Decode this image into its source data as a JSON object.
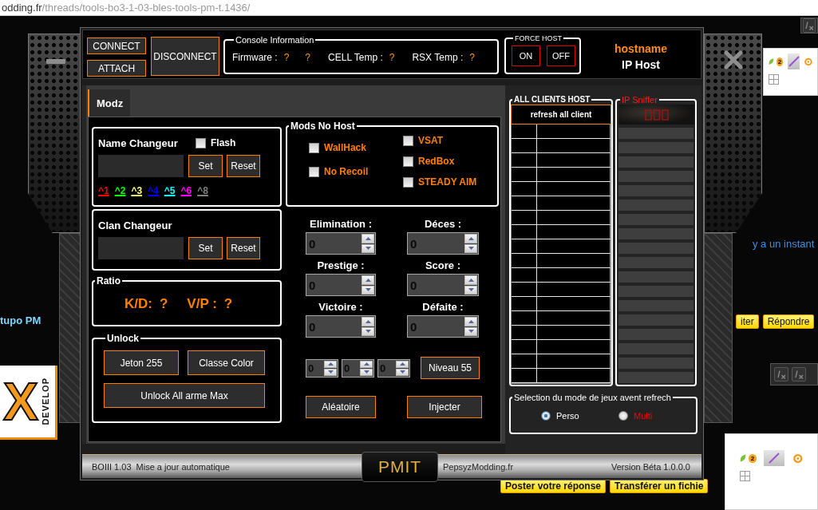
{
  "browser": {
    "url_host": "odding.fr",
    "url_path": "/threads/tools-bo3-1-03-bles-tools-pm-t.1436/"
  },
  "backdrop": {
    "forum_tag": "tupo PM",
    "logo_letter": "X",
    "logo_word": "DEVELOP",
    "post_time": "y a un instant",
    "post_buttons": [
      "iter",
      "Répondre"
    ],
    "reply_buttons": [
      "Poster votre réponse",
      "Transférer un fichie"
    ],
    "tray_panels": [
      {
        "badge": "2"
      },
      {
        "badge": "2"
      }
    ]
  },
  "header": {
    "connect_buttons": [
      "CONNECT",
      "ATTACH"
    ],
    "disconnect": "DISCONNECT",
    "console": {
      "title": "Console Information",
      "items": [
        {
          "label": "Firmware :",
          "values": [
            "?",
            "?"
          ]
        },
        {
          "label": "CELL Temp :",
          "values": [
            "?"
          ]
        },
        {
          "label": "RSX Temp :",
          "values": [
            "?"
          ]
        }
      ]
    },
    "force_host": {
      "title": "FORCE HOST",
      "buttons": [
        "ON",
        "OFF"
      ]
    },
    "hostname": "hostname",
    "ip_host": "IP Host"
  },
  "tabs": [
    {
      "label": "Modz",
      "selected": true
    }
  ],
  "name_changer": {
    "title": "Name Changeur",
    "flash": {
      "label": "Flash",
      "checked": false
    },
    "buttons": [
      "Set",
      "Reset"
    ],
    "color_codes": [
      {
        "label": "^1",
        "color": "#ff0000"
      },
      {
        "label": "^2",
        "color": "#00ff00"
      },
      {
        "label": "^3",
        "color": "#ffff80"
      },
      {
        "label": "^4",
        "color": "#0000ff"
      },
      {
        "label": "^5",
        "color": "#00ffff"
      },
      {
        "label": "^6",
        "color": "#ff00ff"
      },
      {
        "label": "^8",
        "color": "#808080"
      }
    ]
  },
  "clan_changer": {
    "title": "Clan Changeur",
    "buttons": [
      "Set",
      "Reset"
    ]
  },
  "ratio": {
    "title": "Ratio",
    "items": [
      {
        "label": "K/D:",
        "value": "?"
      },
      {
        "label": "V/P :",
        "value": "?"
      }
    ]
  },
  "unlock": {
    "title": "Unlock",
    "buttons": [
      "Jeton 255",
      "Classe Color",
      "Unlock All arme Max"
    ]
  },
  "mods_no_host": {
    "title": "Mods No Host",
    "option_columns": [
      [
        {
          "label": "WallHack",
          "checked": false
        },
        {
          "label": "No Recoil",
          "checked": false
        }
      ],
      [
        {
          "label": "VSAT",
          "checked": false
        },
        {
          "label": "RedBox",
          "checked": false
        },
        {
          "label": "STEADY AIM",
          "checked": false
        }
      ]
    ]
  },
  "stats": [
    {
      "label": "Elimination :",
      "value": "0"
    },
    {
      "label": "Déces :",
      "value": "0"
    },
    {
      "label": "Prestige :",
      "value": "0"
    },
    {
      "label": "Score :",
      "value": "0"
    },
    {
      "label": "Victoire :",
      "value": "0"
    },
    {
      "label": "Défaite :",
      "value": "0"
    }
  ],
  "level_spinners": [
    "0",
    "0",
    "0"
  ],
  "level_button": "Niveau 55",
  "actions": [
    "Aléatoire",
    "Injecter"
  ],
  "clients": {
    "title": "ALL CLIENTS HOST",
    "refresh": "refresh all client"
  },
  "ip_sniffer": {
    "title": "IP Sniffer"
  },
  "mode": {
    "title": "Selection du mode de jeux avent refrech",
    "options": [
      {
        "label": "Perso",
        "selected": true,
        "color": "#ffffff"
      },
      {
        "label": "Multi",
        "selected": false,
        "color": "#ff0000"
      }
    ]
  },
  "status_bar": {
    "app_version": "BOIII 1.03",
    "update_text": "Mise a jour automatique",
    "logo": "PMIT",
    "site": "PepsyzModding.fr",
    "version": "Version Béta 1.0.0.0"
  }
}
